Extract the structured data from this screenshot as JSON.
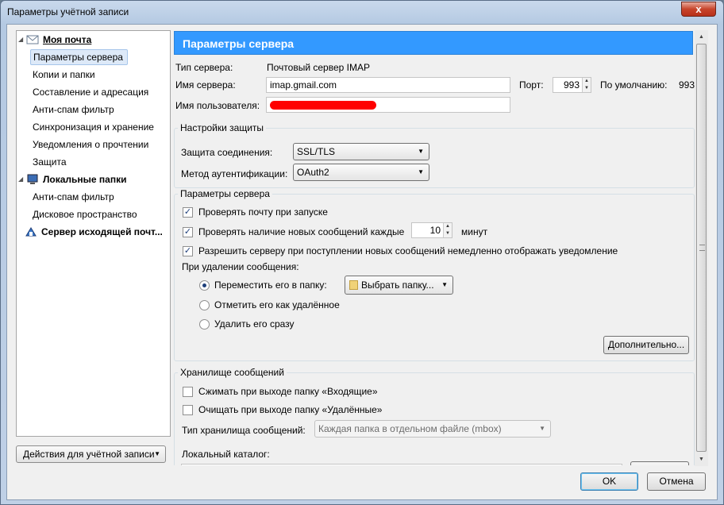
{
  "window": {
    "title": "Параметры учётной записи",
    "close_glyph": "x"
  },
  "sidebar": {
    "items": [
      {
        "label": "Моя почта",
        "parent": true
      },
      {
        "label": "Параметры сервера",
        "selected": true
      },
      {
        "label": "Копии и папки"
      },
      {
        "label": "Составление и адресация"
      },
      {
        "label": "Анти-спам фильтр"
      },
      {
        "label": "Синхронизация и хранение"
      },
      {
        "label": "Уведомления о прочтении"
      },
      {
        "label": "Защита"
      },
      {
        "label": "Локальные папки",
        "parent": true
      },
      {
        "label": "Анти-спам фильтр"
      },
      {
        "label": "Дисковое пространство"
      },
      {
        "label": "Сервер исходящей почт...",
        "parent": true
      }
    ],
    "actions_label": "Действия для учётной записи"
  },
  "main": {
    "header": "Параметры сервера",
    "server_type_label": "Тип сервера:",
    "server_type_value": "Почтовый сервер IMAP",
    "server_name_label": "Имя сервера:",
    "server_name_value": "imap.gmail.com",
    "port_label": "Порт:",
    "port_value": "993",
    "default_label": "По умолчанию:",
    "default_value": "993",
    "username_label": "Имя пользователя:",
    "security": {
      "title": "Настройки защиты",
      "connection_label": "Защита соединения:",
      "connection_value": "SSL/TLS",
      "auth_label": "Метод аутентификации:",
      "auth_value": "OAuth2"
    },
    "server_settings": {
      "title": "Параметры сервера",
      "check_on_start": "Проверять почту при запуске",
      "check_every": "Проверять наличие новых сообщений каждые",
      "check_every_value": "10",
      "minutes": "минут",
      "allow_notify": "Разрешить серверу при поступлении новых сообщений немедленно отображать уведомление",
      "on_delete_label": "При удалении сообщения:",
      "move_to_folder": "Переместить его в папку:",
      "choose_folder": "Выбрать папку...",
      "mark_deleted": "Отметить его как удалённое",
      "delete_now": "Удалить его сразу",
      "advanced_button": "Дополнительно..."
    },
    "storage": {
      "title": "Хранилище сообщений",
      "compact_inbox": "Сжимать при выходе папку «Входящие»",
      "empty_trash": "Очищать при выходе папку «Удалённые»",
      "store_type_label": "Тип хранилища сообщений:",
      "store_type_value": "Каждая папка в отдельном файле (mbox)",
      "local_dir_label": "Локальный каталог:"
    }
  },
  "footer": {
    "ok": "OK",
    "cancel": "Отмена"
  },
  "colors": {
    "header_bg": "#3399ff",
    "redaction": "#ff0000",
    "selection": "#dde9f8"
  }
}
